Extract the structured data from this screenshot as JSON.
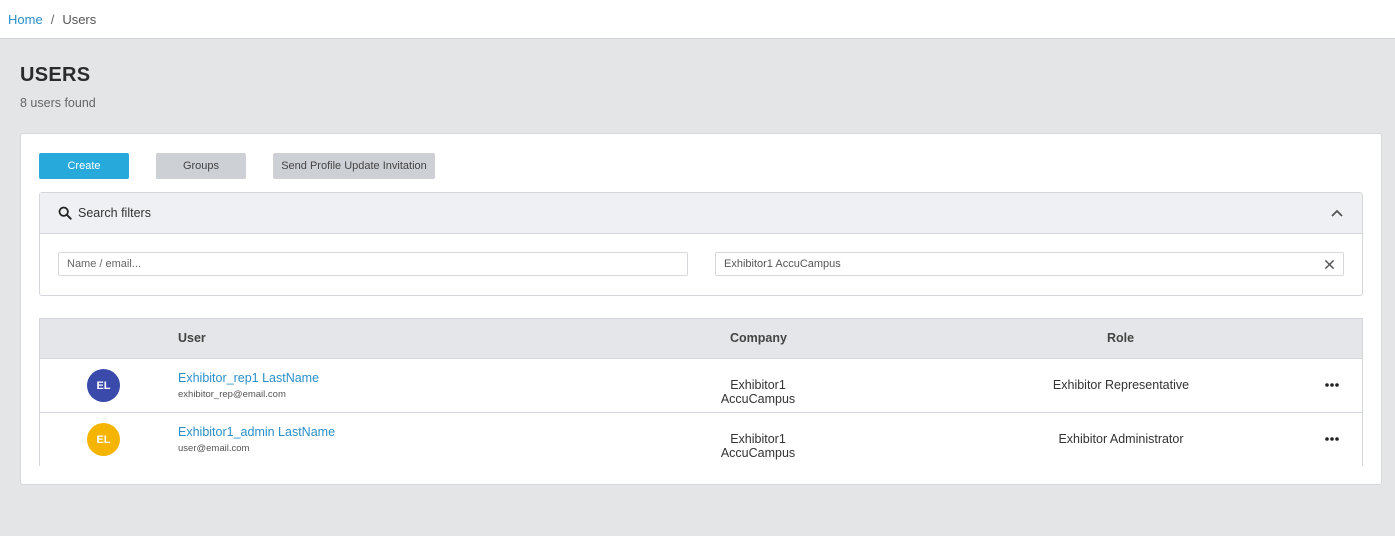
{
  "breadcrumb": {
    "home": "Home",
    "separator": "/",
    "current": "Users"
  },
  "page": {
    "title": "USERS",
    "count": "8 users found"
  },
  "toolbar": {
    "create": "Create",
    "groups": "Groups",
    "invite": "Send Profile Update Invitation"
  },
  "filters": {
    "title": "Search filters",
    "name_placeholder": "Name / email...",
    "company_value": "Exhibitor1 AccuCampus"
  },
  "table": {
    "headers": {
      "user": "User",
      "company": "Company",
      "role": "Role"
    },
    "rows": [
      {
        "initials": "EL",
        "avatar_color": "#3a4aab",
        "name": "Exhibitor_rep1 LastName",
        "email": "exhibitor_rep@email.com",
        "company": "Exhibitor1 AccuCampus",
        "role": "Exhibitor Representative"
      },
      {
        "initials": "EL",
        "avatar_color": "#f5b400",
        "name": "Exhibitor1_admin LastName",
        "email": "user@email.com",
        "company": "Exhibitor1 AccuCampus",
        "role": "Exhibitor Administrator"
      }
    ]
  },
  "colors": {
    "accent": "#27a9dc",
    "link": "#2a8fc7"
  }
}
